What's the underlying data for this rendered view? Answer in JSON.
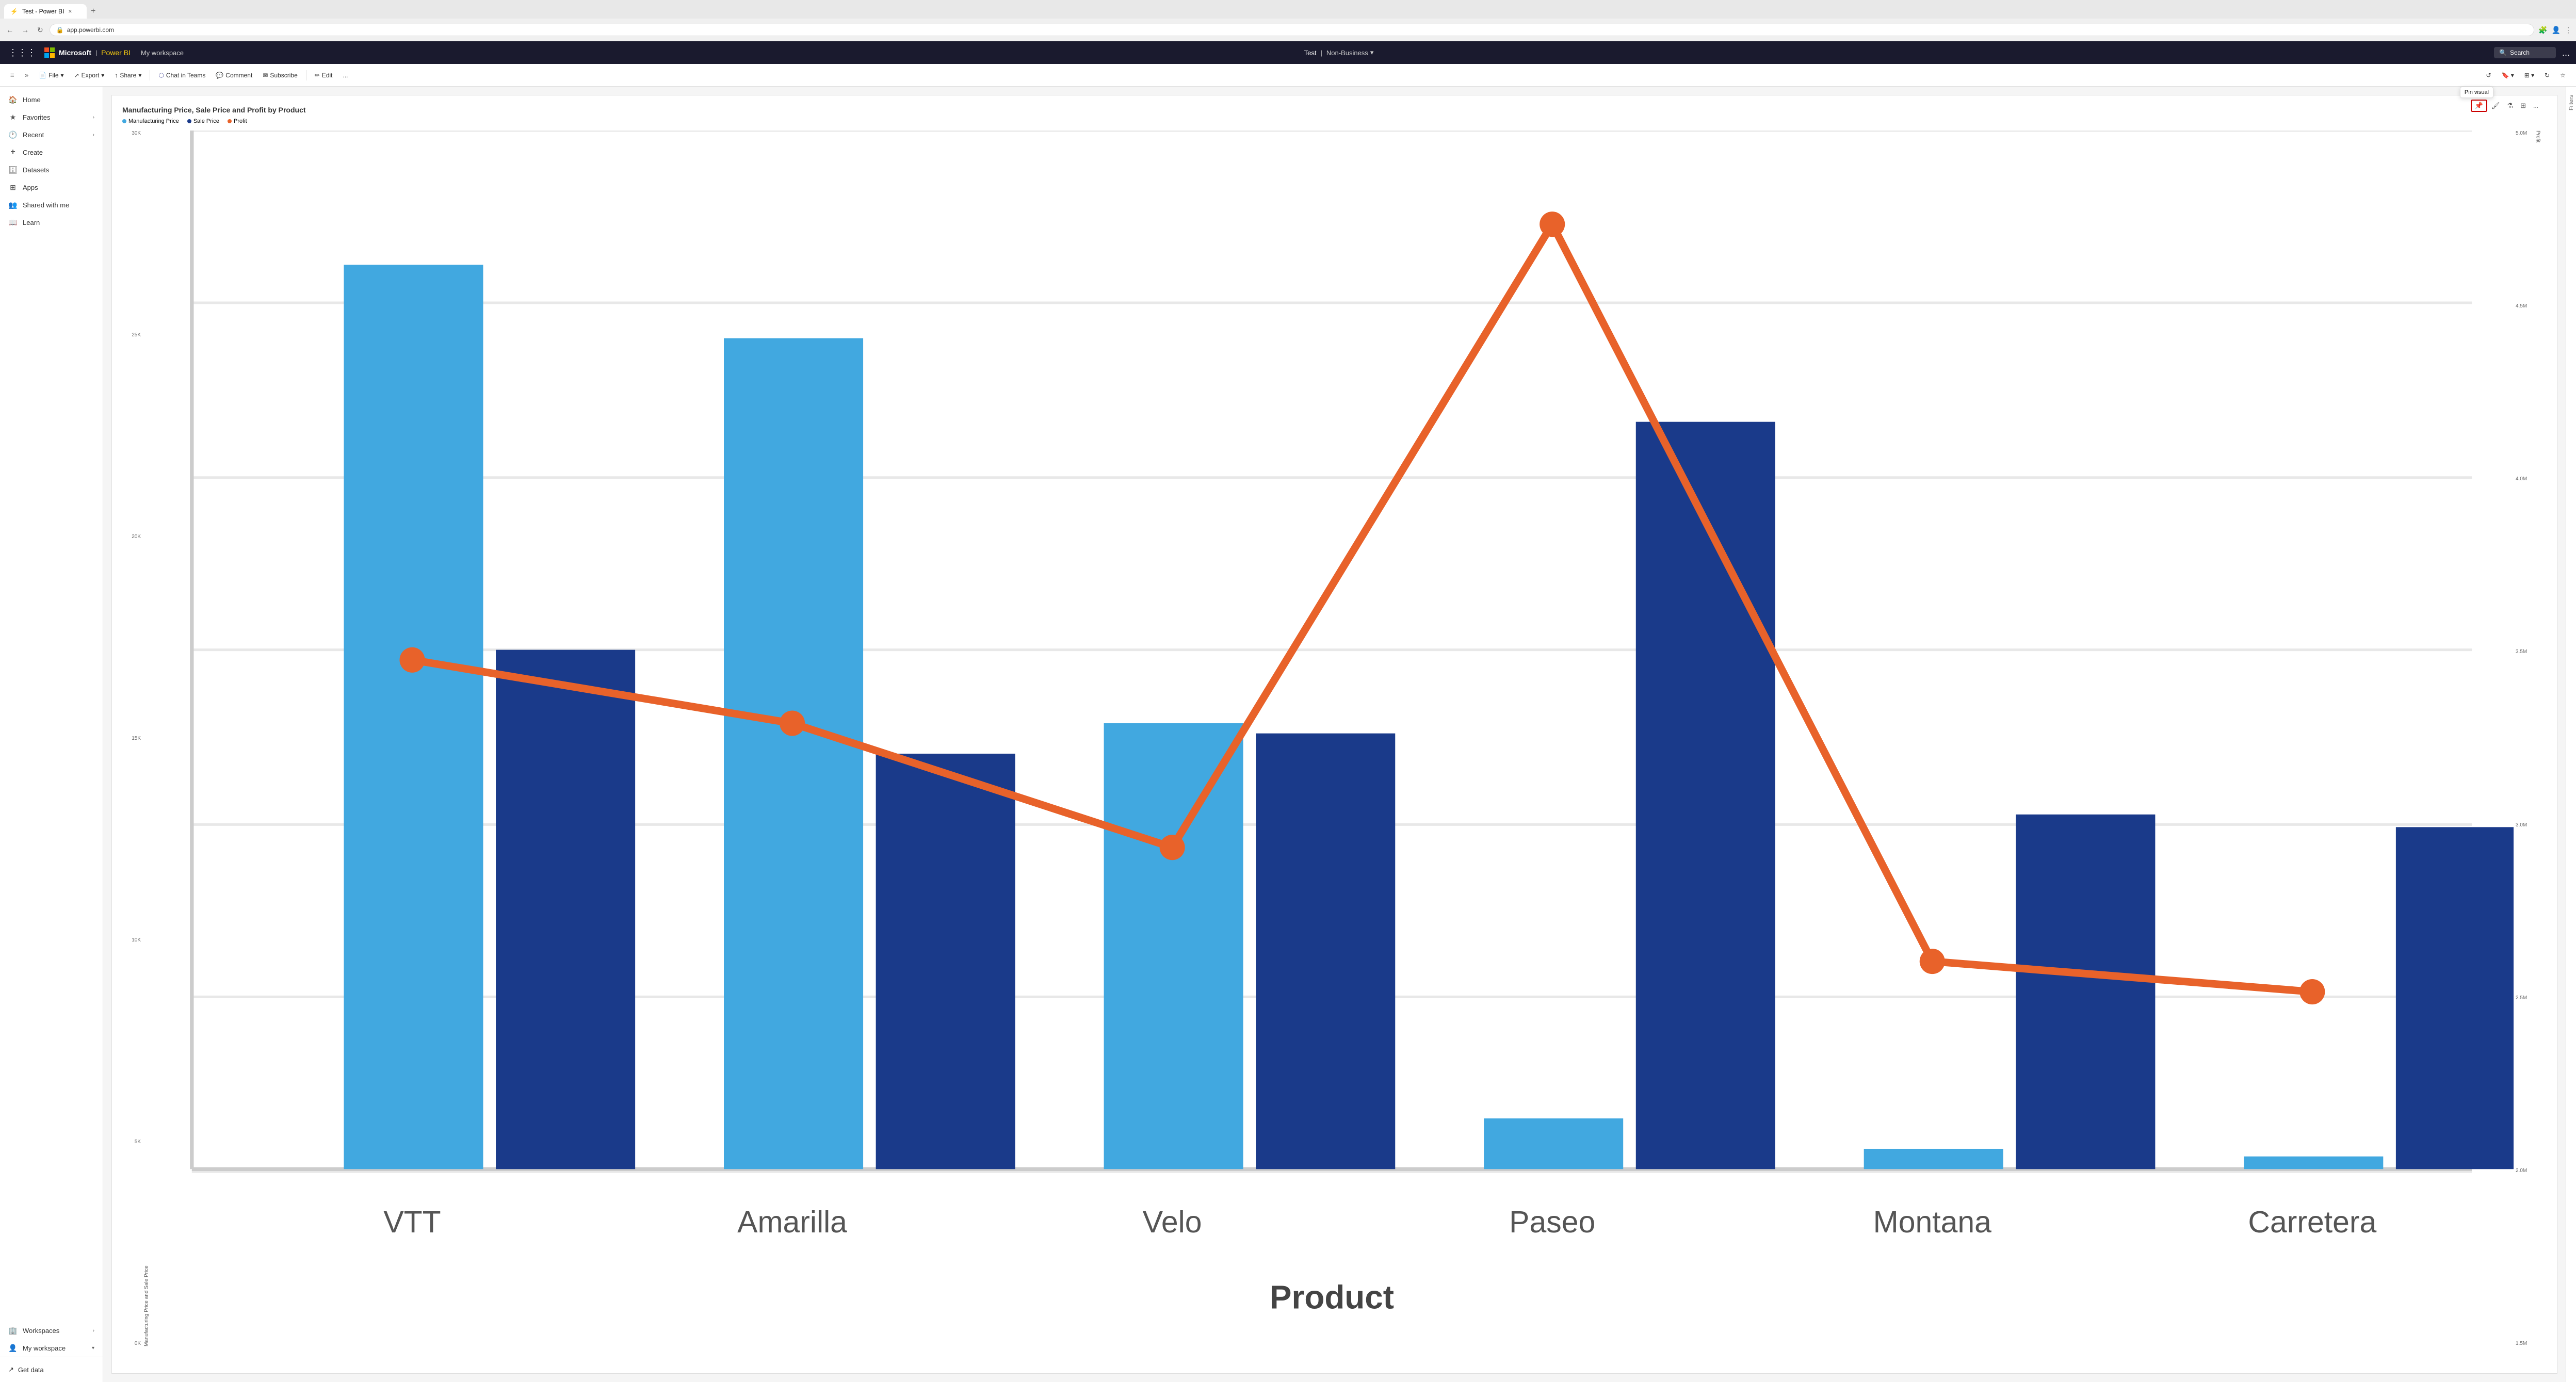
{
  "browser": {
    "tab_title": "Test - Power BI",
    "tab_close": "×",
    "tab_add": "+",
    "nav_back": "←",
    "nav_forward": "→",
    "nav_refresh": "↻",
    "url": "app.powerbi.com"
  },
  "topbar": {
    "waffle_icon": "⋮⋮⋮",
    "brand": "Microsoft",
    "powerbi": "Power BI",
    "workspace": "My workspace",
    "report_name": "Test",
    "sensitivity": "Non-Business",
    "search_placeholder": "Search",
    "more": "..."
  },
  "toolbar": {
    "collapse_icon": "≡",
    "expand_icon": "»",
    "file_label": "File",
    "export_label": "Export",
    "share_label": "Share",
    "chat_teams_label": "Chat in Teams",
    "comment_label": "Comment",
    "subscribe_label": "Subscribe",
    "edit_label": "Edit",
    "more_label": "...",
    "pin_tooltip": "Pin visual",
    "reset_icon": "↺",
    "bookmark_icon": "🔖",
    "fullscreen_icon": "⛶",
    "refresh_icon": "↻",
    "favorite_icon": "☆"
  },
  "visual_toolbar": {
    "pin_icon": "📌",
    "format_icon": "🖌",
    "filter_icon": "⚗",
    "focus_icon": "⊞",
    "more_icon": "..."
  },
  "sidebar": {
    "items": [
      {
        "id": "home",
        "icon": "🏠",
        "label": "Home"
      },
      {
        "id": "favorites",
        "icon": "★",
        "label": "Favorites",
        "has_arrow": true
      },
      {
        "id": "recent",
        "icon": "🕐",
        "label": "Recent",
        "has_arrow": true
      },
      {
        "id": "create",
        "icon": "+",
        "label": "Create"
      },
      {
        "id": "datasets",
        "icon": "🗄",
        "label": "Datasets"
      },
      {
        "id": "apps",
        "icon": "⊞",
        "label": "Apps"
      },
      {
        "id": "shared",
        "icon": "👥",
        "label": "Shared with me"
      },
      {
        "id": "learn",
        "icon": "📖",
        "label": "Learn"
      },
      {
        "id": "workspaces",
        "icon": "🏢",
        "label": "Workspaces",
        "has_arrow": true
      },
      {
        "id": "my-workspace",
        "icon": "👤",
        "label": "My workspace",
        "has_arrow": true
      }
    ],
    "get_data_icon": "↗",
    "get_data_label": "Get data"
  },
  "chart": {
    "title": "Manufacturing Price, Sale Price and Profit by Product",
    "legend": [
      {
        "label": "Manufacturing Price",
        "color": "#41a8e0"
      },
      {
        "label": "Sale Price",
        "color": "#1a3a8a"
      },
      {
        "label": "Profit",
        "color": "#e8622a"
      }
    ],
    "y_left_ticks": [
      "30K",
      "25K",
      "20K",
      "15K",
      "10K",
      "5K",
      "0K"
    ],
    "y_right_ticks": [
      "5.0M",
      "4.5M",
      "4.0M",
      "3.5M",
      "3.0M",
      "2.5M",
      "2.0M",
      "1.5M"
    ],
    "y_left_label": "Manufacturing Price and Sale Price",
    "y_right_label": "Profit",
    "x_label": "Product",
    "products": [
      "VTT",
      "Amarilla",
      "Velo",
      "Paseo",
      "Montana",
      "Carretera"
    ],
    "bars": {
      "VTT": {
        "mfg": 0.87,
        "sale": 0.5,
        "profit_line": 0.62
      },
      "Amarilla": {
        "mfg": 0.8,
        "sale": 0.4,
        "profit_line": 0.54
      },
      "Velo": {
        "mfg": 0.43,
        "sale": 0.42,
        "profit_line": 0.3
      },
      "Paseo": {
        "mfg": 0.05,
        "sale": 0.72,
        "profit_line": 0.92
      },
      "Montana": {
        "mfg": 0.02,
        "sale": 0.34,
        "profit_line": 0.15
      },
      "Carretera": {
        "mfg": 0.01,
        "sale": 0.33,
        "profit_line": 0.1
      }
    }
  },
  "filters": {
    "label": "Filters"
  }
}
